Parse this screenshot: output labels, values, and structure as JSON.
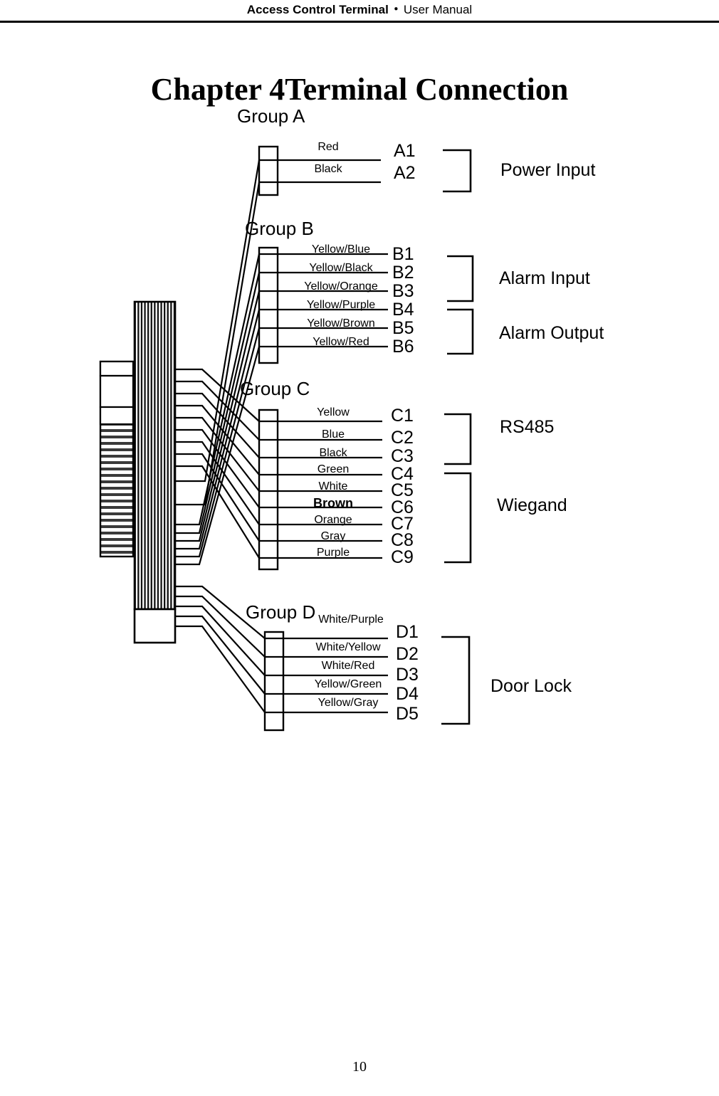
{
  "header": {
    "title_strong": "Access Control Terminal",
    "separator": "・",
    "title_light": "User Manual"
  },
  "chapter": {
    "title": "Chapter 4Terminal Connection"
  },
  "footer": {
    "page_number": "10"
  },
  "diagram": {
    "groups": [
      {
        "name": "Group A",
        "wires": [
          {
            "color": "Red",
            "terminal": "A1"
          },
          {
            "color": "Black",
            "terminal": "A2"
          }
        ],
        "functions": [
          {
            "label": "Power Input",
            "terminals": [
              "A1",
              "A2"
            ]
          }
        ]
      },
      {
        "name": "Group B",
        "wires": [
          {
            "color": "Yellow/Blue",
            "terminal": "B1"
          },
          {
            "color": "Yellow/Black",
            "terminal": "B2"
          },
          {
            "color": "Yellow/Orange",
            "terminal": "B3"
          },
          {
            "color": "Yellow/Purple",
            "terminal": "B4"
          },
          {
            "color": "Yellow/Brown",
            "terminal": "B5"
          },
          {
            "color": "Yellow/Red",
            "terminal": "B6"
          }
        ],
        "functions": [
          {
            "label": "Alarm Input",
            "terminals": [
              "B1",
              "B2",
              "B3"
            ]
          },
          {
            "label": "Alarm Output",
            "terminals": [
              "B4",
              "B5",
              "B6"
            ]
          }
        ]
      },
      {
        "name": "Group C",
        "wires": [
          {
            "color": "Yellow",
            "terminal": "C1"
          },
          {
            "color": "Blue",
            "terminal": "C2"
          },
          {
            "color": "Black",
            "terminal": "C3"
          },
          {
            "color": "Green",
            "terminal": "C4"
          },
          {
            "color": "White",
            "terminal": "C5"
          },
          {
            "color": "Brown",
            "terminal": "C6"
          },
          {
            "color": "Orange",
            "terminal": "C7"
          },
          {
            "color": "Gray",
            "terminal": "C8"
          },
          {
            "color": "Purple",
            "terminal": "C9"
          }
        ],
        "functions": [
          {
            "label": "RS485",
            "terminals": [
              "C1",
              "C2",
              "C3"
            ]
          },
          {
            "label": "Wiegand",
            "terminals": [
              "C4",
              "C5",
              "C6",
              "C7",
              "C8",
              "C9"
            ]
          }
        ]
      },
      {
        "name": "Group D",
        "wires": [
          {
            "color": "White/Purple",
            "terminal": "D1"
          },
          {
            "color": "White/Yellow",
            "terminal": "D2"
          },
          {
            "color": "White/Red",
            "terminal": "D3"
          },
          {
            "color": "Yellow/Green",
            "terminal": "D4"
          },
          {
            "color": "Yellow/Gray",
            "terminal": "D5"
          }
        ],
        "functions": [
          {
            "label": "Door Lock",
            "terminals": [
              "D1",
              "D2",
              "D3",
              "D4",
              "D5"
            ]
          }
        ]
      }
    ]
  },
  "colors": {
    "ink": "#000000",
    "paper": "#ffffff"
  }
}
